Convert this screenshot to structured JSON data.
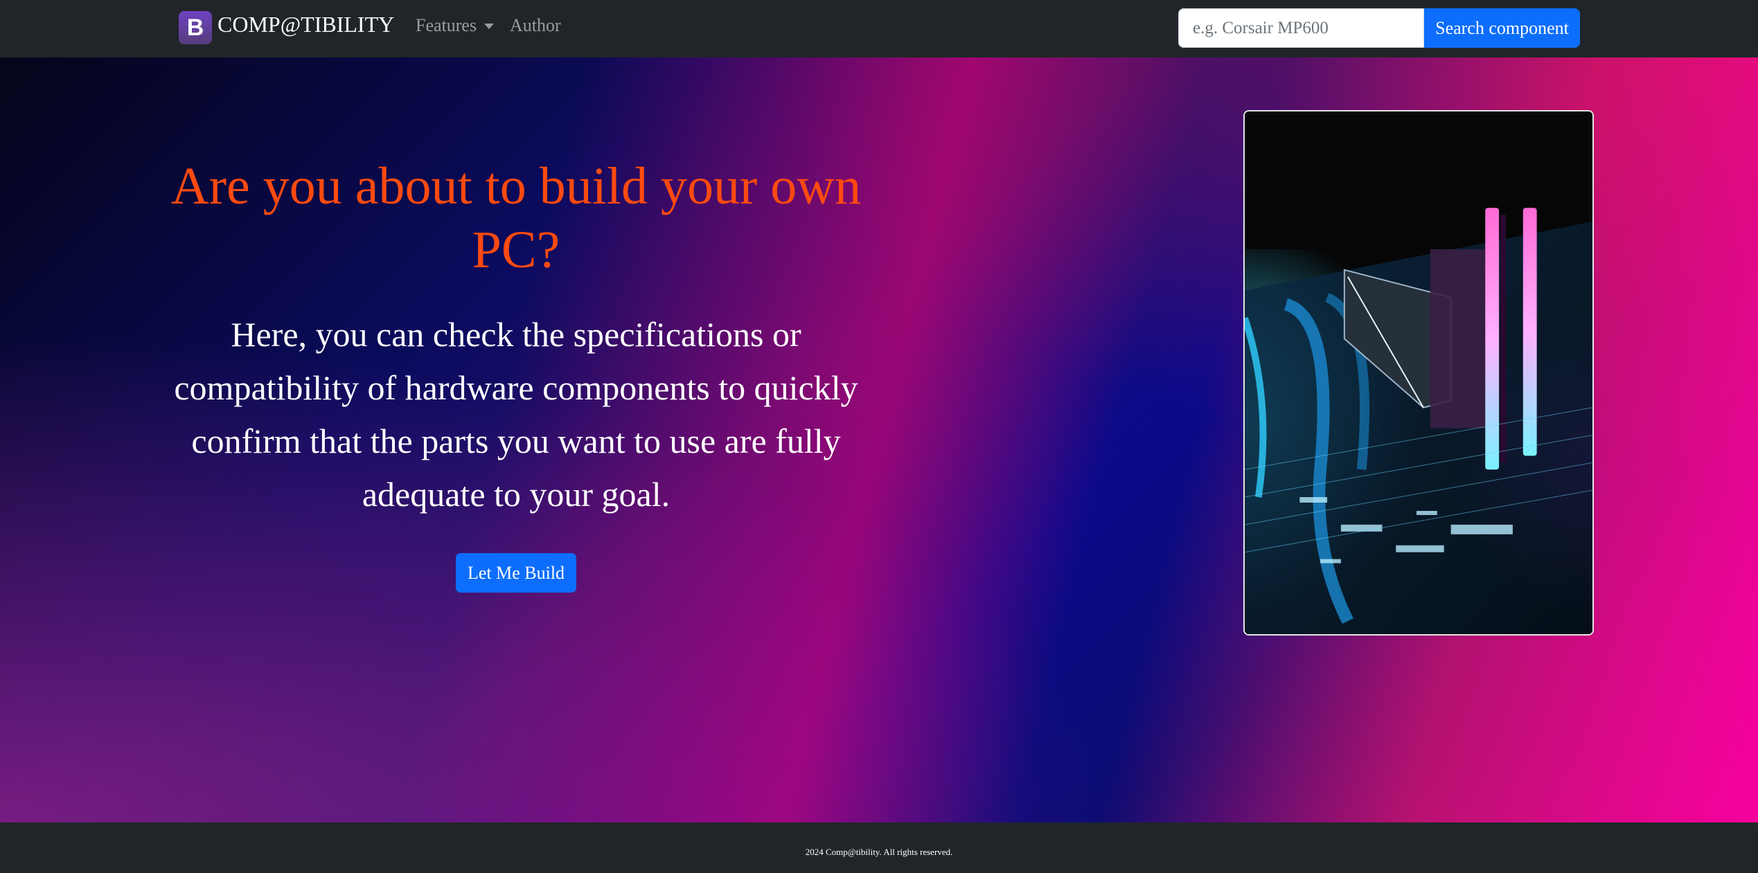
{
  "navbar": {
    "brand_logo": "B",
    "brand_name": "COMP@TIBILITY",
    "features_label": "Features",
    "author_label": "Author",
    "search_placeholder": "e.g. Corsair MP600",
    "search_button_label": "Search component"
  },
  "hero": {
    "headline": "Are you about to build your own PC?",
    "lead": "Here, you can check the specifications or compatibility of hardware components to quickly confirm that the parts you want to use are fully adequate to your goal.",
    "cta_label": "Let Me Build"
  },
  "footer": {
    "text": "2024 Comp@tibility. All rights reserved."
  },
  "colors": {
    "primary": "#0d6efd",
    "headline": "#ff4a10",
    "navbar_bg": "#212529",
    "brand_logo_bg": "#6f42c1"
  }
}
